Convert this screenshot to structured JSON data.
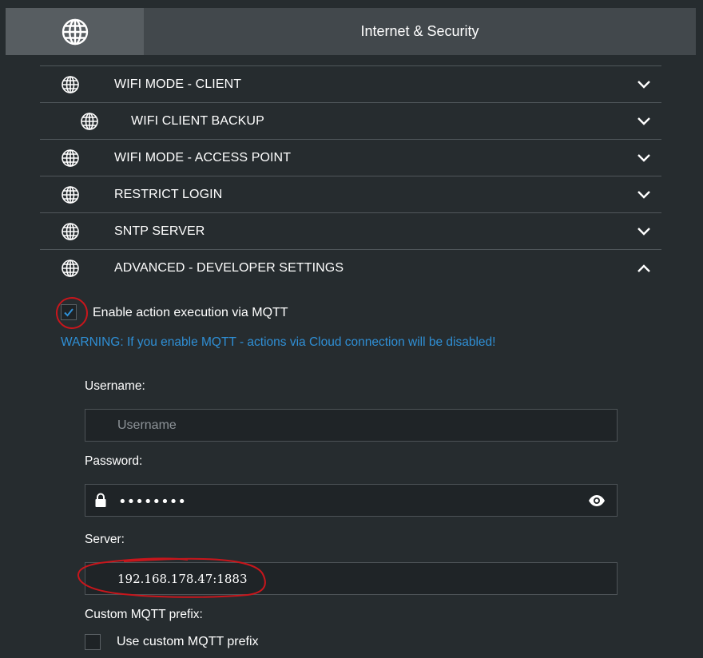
{
  "header": {
    "title": "Internet & Security",
    "icon": "globe-icon"
  },
  "menu": {
    "items": [
      {
        "label": "WIFI MODE - CLIENT",
        "icon": "globe-icon",
        "state": "collapsed"
      },
      {
        "label": "WIFI CLIENT BACKUP",
        "icon": "globe-icon",
        "state": "collapsed",
        "nested": true
      },
      {
        "label": "WIFI MODE - ACCESS POINT",
        "icon": "globe-icon",
        "state": "collapsed"
      },
      {
        "label": "RESTRICT LOGIN",
        "icon": "globe-icon",
        "state": "collapsed"
      },
      {
        "label": "SNTP SERVER",
        "icon": "globe-icon",
        "state": "collapsed"
      },
      {
        "label": "ADVANCED - DEVELOPER SETTINGS",
        "icon": "globe-icon",
        "state": "expanded"
      }
    ]
  },
  "advanced": {
    "mqtt_enable_label": "Enable action execution via MQTT",
    "mqtt_enable_checked": true,
    "warning": "WARNING: If you enable MQTT - actions via Cloud connection will be disabled!",
    "username_label": "Username:",
    "username_placeholder": "Username",
    "username_value": "",
    "password_label": "Password:",
    "password_mask": "••••••••",
    "server_label": "Server:",
    "server_value": "192.168.178.47:1883",
    "custom_prefix_label": "Custom MQTT prefix:",
    "use_custom_prefix_label": "Use custom MQTT prefix",
    "use_custom_prefix_checked": false
  },
  "colors": {
    "background": "#262c2f",
    "header": "#42484c",
    "header_icon_box": "#575d61",
    "warning": "#2f8fd5",
    "checkmark": "#2f8fd5",
    "annotation": "#c8161c"
  }
}
